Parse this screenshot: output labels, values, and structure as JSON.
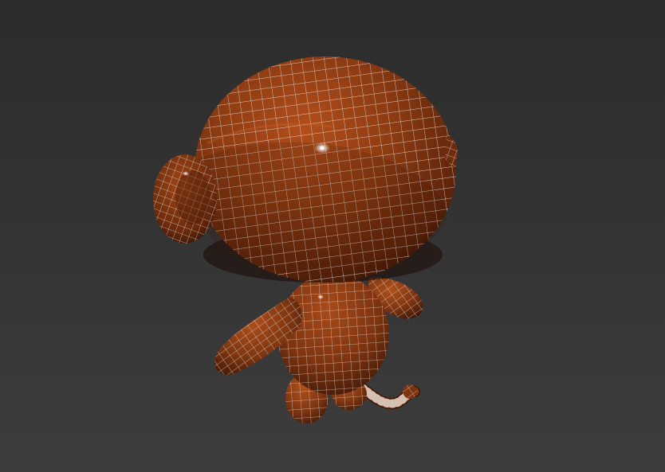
{
  "viewport": {
    "background_top": "#2c2c2c",
    "background_bottom": "#3d3d3d",
    "object": "monkey-character-mesh",
    "shading": "smooth-with-wireframe-overlay"
  },
  "material": {
    "base_color": "#8a3a12",
    "highlight_color": "#c2571f",
    "shadow_color": "#3a1404",
    "wire_color": "#e6e0d8"
  }
}
